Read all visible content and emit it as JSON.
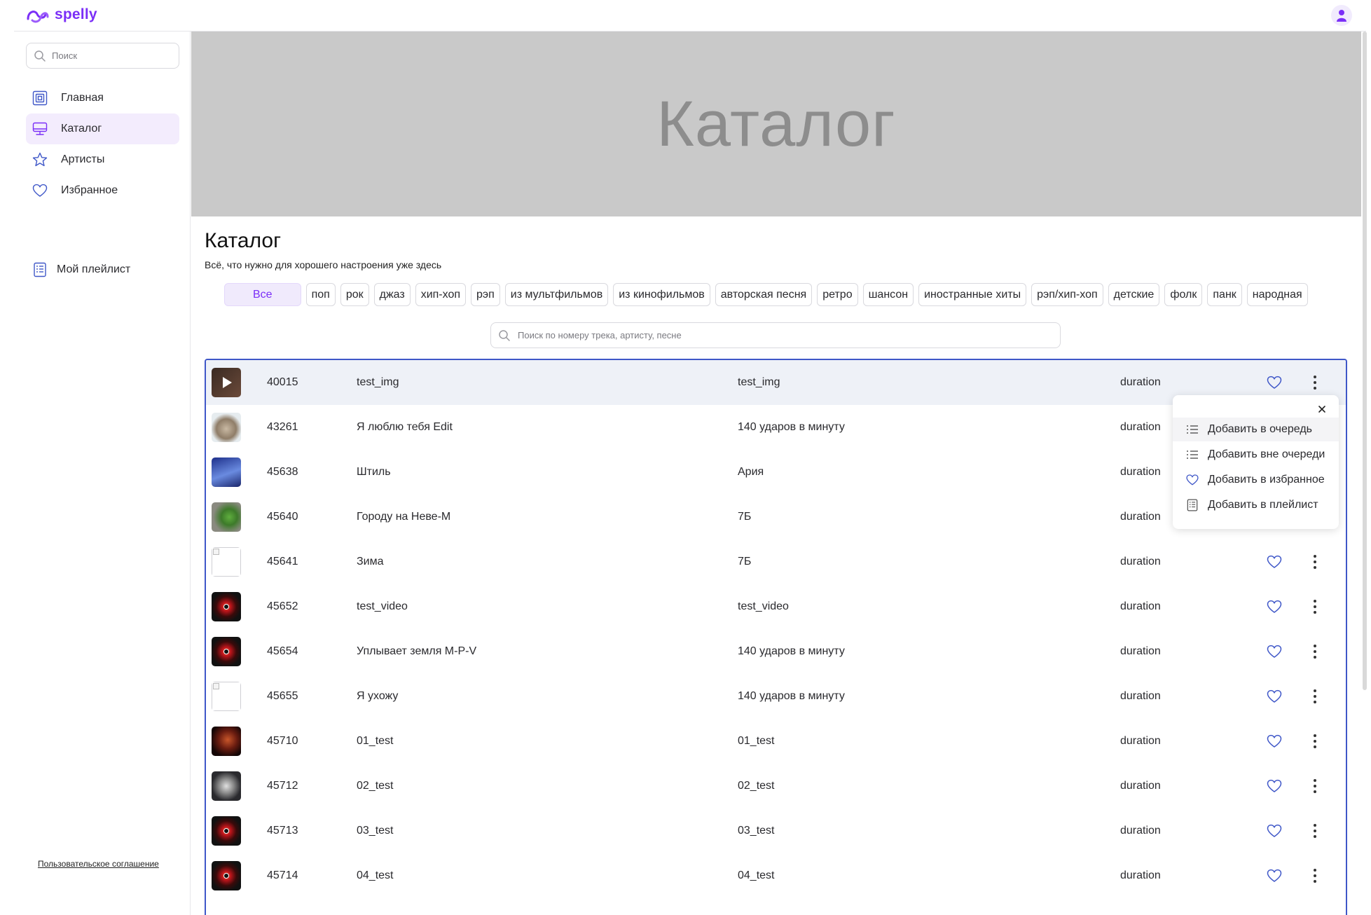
{
  "app": {
    "name": "spelly"
  },
  "sidebar": {
    "search_placeholder": "Поиск",
    "items": [
      {
        "label": "Главная"
      },
      {
        "label": "Каталог"
      },
      {
        "label": "Артисты"
      },
      {
        "label": "Избранное"
      }
    ],
    "playlist_label": "Мой плейлист",
    "terms_label": "Пользовательское соглашение"
  },
  "banner": {
    "text": "Каталог"
  },
  "page": {
    "title": "Каталог",
    "subtitle": "Всё, что нужно для хорошего настроения уже здесь"
  },
  "genres": [
    "Все",
    "поп",
    "рок",
    "джаз",
    "хип-хоп",
    "рэп",
    "из мультфильмов",
    "из кинофильмов",
    "авторская песня",
    "ретро",
    "шансон",
    "иностранные хиты",
    "рэп/хип-хоп",
    "детские",
    "фолк",
    "панк",
    "народная"
  ],
  "track_search": {
    "placeholder": "Поиск по номеру трека, артисту, песне"
  },
  "tracks": [
    {
      "id": "40015",
      "title": "test_img",
      "artist": "test_img",
      "duration": "duration",
      "thumb": "play"
    },
    {
      "id": "43261",
      "title": "Я люблю тебя Edit",
      "artist": "140 ударов в минуту",
      "duration": "duration",
      "thumb": "cat"
    },
    {
      "id": "45638",
      "title": "Штиль",
      "artist": "Ария",
      "duration": "duration",
      "thumb": "blue"
    },
    {
      "id": "45640",
      "title": "Городу на Неве-М",
      "artist": "7Б",
      "duration": "duration",
      "thumb": "parrot"
    },
    {
      "id": "45641",
      "title": "Зима",
      "artist": "7Б",
      "duration": "duration",
      "thumb": "broken"
    },
    {
      "id": "45652",
      "title": "test_video",
      "artist": "test_video",
      "duration": "duration",
      "thumb": "disc"
    },
    {
      "id": "45654",
      "title": "Уплывает земля M-P-V",
      "artist": "140 ударов в минуту",
      "duration": "duration",
      "thumb": "disc"
    },
    {
      "id": "45655",
      "title": "Я ухожу",
      "artist": "140 ударов в минуту",
      "duration": "duration",
      "thumb": "broken"
    },
    {
      "id": "45710",
      "title": "01_test",
      "artist": "01_test",
      "duration": "duration",
      "thumb": "dark"
    },
    {
      "id": "45712",
      "title": "02_test",
      "artist": "02_test",
      "duration": "duration",
      "thumb": "face"
    },
    {
      "id": "45713",
      "title": "03_test",
      "artist": "03_test",
      "duration": "duration",
      "thumb": "disc"
    },
    {
      "id": "45714",
      "title": "04_test",
      "artist": "04_test",
      "duration": "duration",
      "thumb": "disc"
    }
  ],
  "context_menu": {
    "items": [
      {
        "label": "Добавить в очередь",
        "icon": "list-icon"
      },
      {
        "label": "Добавить вне очереди",
        "icon": "list-icon"
      },
      {
        "label": "Добавить в избранное",
        "icon": "heart-icon"
      },
      {
        "label": "Добавить в плейлист",
        "icon": "playlist-icon"
      }
    ]
  },
  "colors": {
    "accent": "#7b2ff7",
    "banner": "#c9c9c9",
    "table_border": "#3f57c8"
  }
}
